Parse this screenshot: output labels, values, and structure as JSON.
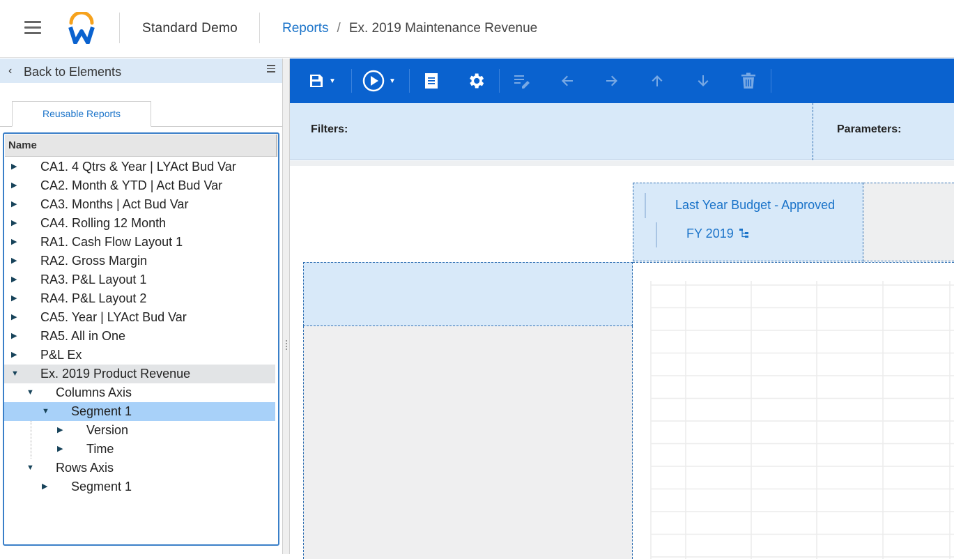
{
  "header": {
    "tenant": "Standard Demo",
    "breadcrumb": {
      "link": "Reports",
      "separator": "/",
      "current": "Ex. 2019 Maintenance Revenue"
    }
  },
  "left_panel": {
    "back_label": "Back to Elements",
    "tab": "Reusable Reports",
    "column_header": "Name",
    "tree": [
      {
        "label": "CA1. 4 Qtrs & Year | LYAct Bud Var",
        "expanded": false
      },
      {
        "label": "CA2. Month & YTD | Act Bud Var",
        "expanded": false
      },
      {
        "label": "CA3. Months | Act Bud Var",
        "expanded": false
      },
      {
        "label": "CA4. Rolling 12 Month",
        "expanded": false
      },
      {
        "label": "RA1. Cash Flow Layout 1",
        "expanded": false
      },
      {
        "label": "RA2. Gross Margin",
        "expanded": false
      },
      {
        "label": "RA3. P&L Layout 1",
        "expanded": false
      },
      {
        "label": "RA4. P&L Layout 2",
        "expanded": false
      },
      {
        "label": "CA5. Year | LYAct Bud Var",
        "expanded": false
      },
      {
        "label": "RA5. All in One",
        "expanded": false
      },
      {
        "label": "P&L Ex",
        "expanded": false
      },
      {
        "label": "Ex. 2019 Product Revenue",
        "expanded": true
      },
      {
        "label": "Columns Axis",
        "expanded": true
      },
      {
        "label": "Segment 1",
        "expanded": true,
        "selected": true
      },
      {
        "label": "Version",
        "expanded": false
      },
      {
        "label": "Time",
        "expanded": false
      },
      {
        "label": "Rows Axis",
        "expanded": true
      },
      {
        "label": "Segment 1",
        "expanded": false
      }
    ]
  },
  "toolbar": {
    "icons": [
      "save-icon",
      "run-icon",
      "document-icon",
      "settings-icon",
      "edit-icon",
      "arrow-left-icon",
      "arrow-right-icon",
      "arrow-up-icon",
      "arrow-down-icon",
      "trash-icon"
    ]
  },
  "filter_bar": {
    "filters_label": "Filters:",
    "parameters_label": "Parameters:"
  },
  "canvas": {
    "column_version": "Last Year Budget - Approved",
    "column_time": "FY 2019"
  },
  "colors": {
    "accent": "#0a62cf",
    "link": "#1a73c9",
    "selection": "#a8d1f9",
    "panel_blue": "#d8e9f9"
  }
}
